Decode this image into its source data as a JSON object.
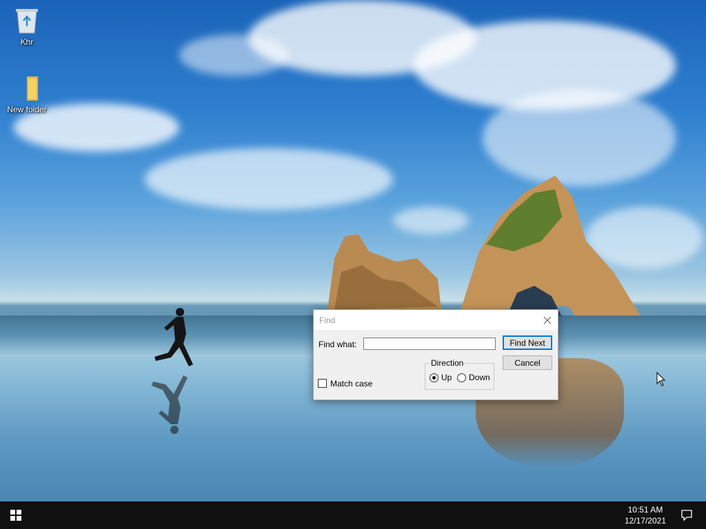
{
  "desktop": {
    "icons": [
      {
        "label": "Khr",
        "icon": "recycle-bin-icon"
      },
      {
        "label": "New folder",
        "icon": "folder-icon"
      }
    ]
  },
  "find_dialog": {
    "title": "Find",
    "find_what_label": "Find what:",
    "find_what_value": "",
    "find_next_label": "Find Next",
    "cancel_label": "Cancel",
    "direction": {
      "legend": "Direction",
      "up_label": "Up",
      "down_label": "Down",
      "selected": "Up"
    },
    "match_case_label": "Match case",
    "match_case_checked": false
  },
  "taskbar": {
    "time": "10:51 AM",
    "date": "12/17/2021"
  },
  "colors": {
    "taskbar_bg": "#101010",
    "dialog_bg": "#f0f0f0",
    "accent": "#0078d7"
  }
}
